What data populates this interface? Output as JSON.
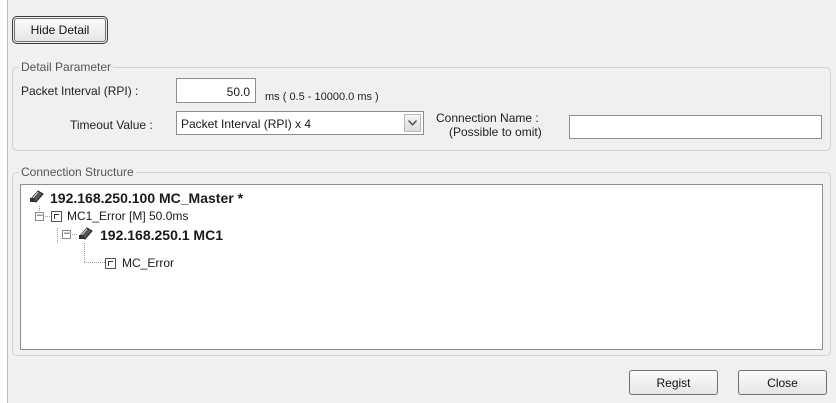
{
  "buttons": {
    "hide_detail": "Hide Detail",
    "regist": "Regist",
    "close": "Close"
  },
  "detail": {
    "legend": "Detail Parameter",
    "rpi_label": "Packet Interval (RPI) :",
    "rpi_value": "50.0",
    "rpi_range": "ms ( 0.5 - 10000.0 ms )",
    "timeout_label": "Timeout Value :",
    "timeout_value": "Packet Interval (RPI) x 4",
    "connname_label_line1": "Connection Name :",
    "connname_label_line2": "(Possible to omit)",
    "connname_value": ""
  },
  "structure": {
    "legend": "Connection Structure",
    "nodes": [
      {
        "text": "192.168.250.100 MC_Master *",
        "icon": "network-device-icon"
      },
      {
        "text": "MC1_Error [M] 50.0ms",
        "icon": "module-icon",
        "expander": "−"
      },
      {
        "text": "192.168.250.1 MC1",
        "icon": "network-device-icon",
        "expander": "−"
      },
      {
        "text": "MC_Error",
        "icon": "module-icon"
      }
    ]
  }
}
